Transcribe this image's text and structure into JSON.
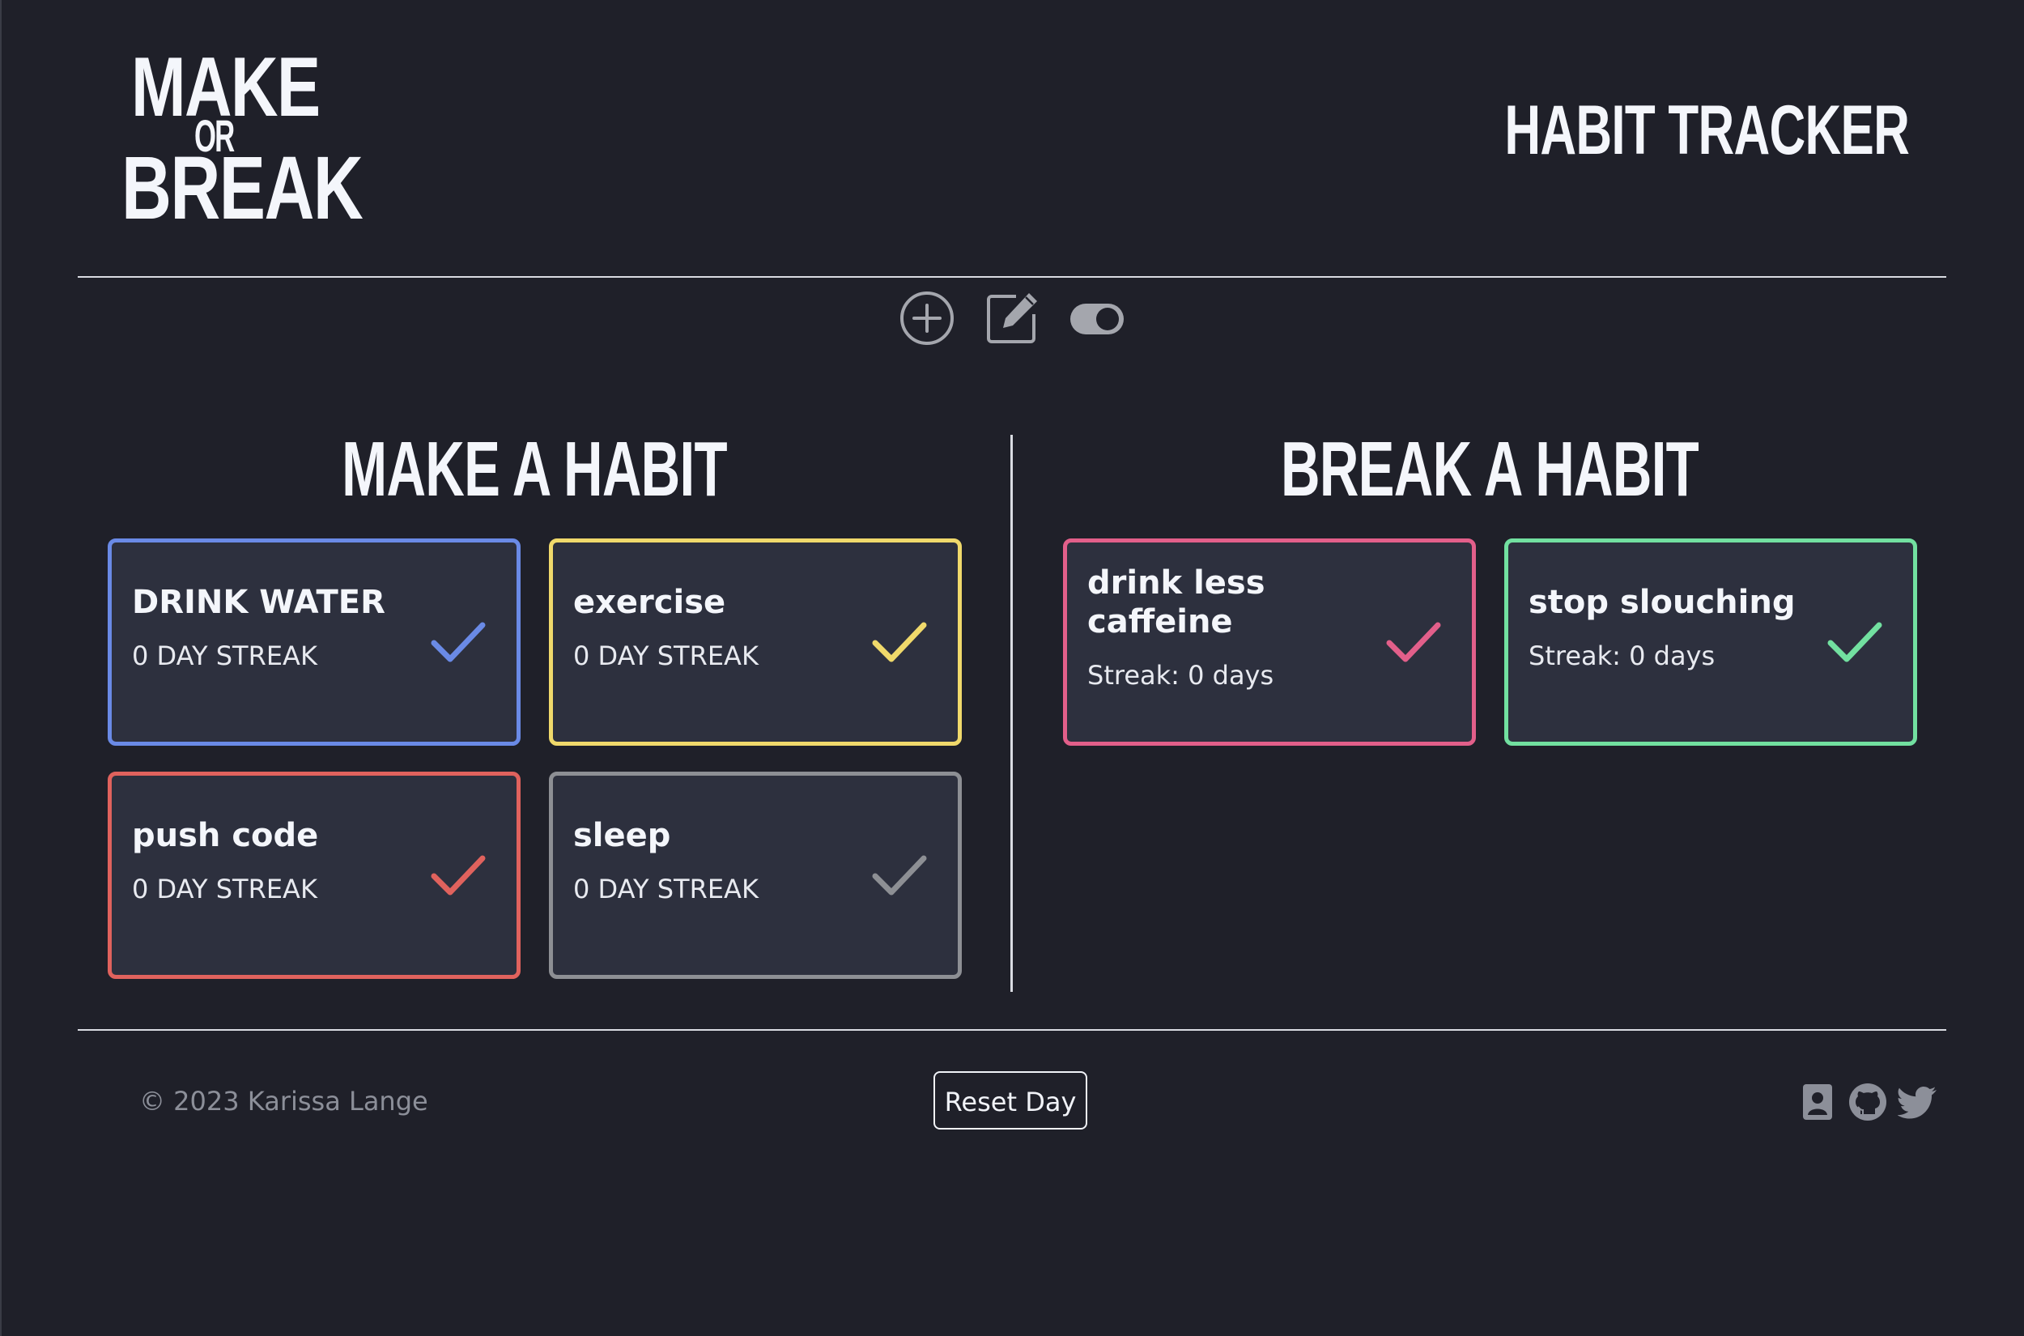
{
  "header": {
    "logo": {
      "line1": "MAKE",
      "line2": "OR",
      "line3": "BREAK"
    },
    "title": "HABIT TRACKER"
  },
  "toolbar": {
    "icons": [
      "add-circle-icon",
      "edit-icon",
      "toggle-icon"
    ]
  },
  "make_section": {
    "title": "MAKE A HABIT",
    "habits": [
      {
        "name": "DRINK WATER",
        "streak": "0 DAY STREAK",
        "color": "#6a8ae6"
      },
      {
        "name": "exercise",
        "streak": "0 DAY STREAK",
        "color": "#f0d96b"
      },
      {
        "name": "push code",
        "streak": "0 DAY STREAK",
        "color": "#e0625d"
      },
      {
        "name": "sleep",
        "streak": "0 DAY STREAK",
        "color": "#8d8f94"
      }
    ]
  },
  "break_section": {
    "title": "BREAK A HABIT",
    "habits": [
      {
        "name": "drink less caffeine",
        "streak": "Streak: 0 days",
        "color": "#e25f8a"
      },
      {
        "name": "stop slouching",
        "streak": "Streak: 0 days",
        "color": "#72e0a0"
      }
    ]
  },
  "footer": {
    "copyright": "© 2023 Karissa Lange",
    "reset_label": "Reset Day",
    "social_icons": [
      "contact-icon",
      "github-icon",
      "twitter-icon"
    ]
  },
  "colors": {
    "background": "#1f2029",
    "card_background": "#2d303e",
    "toolbar_icon": "#a4a6ad",
    "footer_text": "#8c8f99"
  }
}
